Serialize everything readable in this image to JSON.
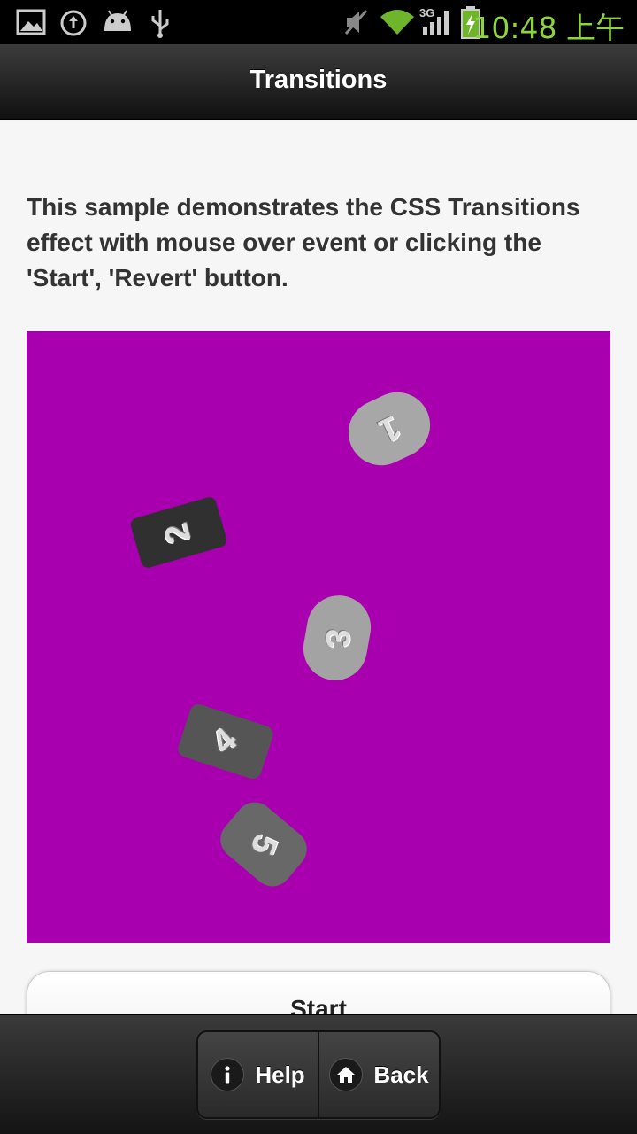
{
  "status_bar": {
    "time": "10:48 上午",
    "icons": [
      "gallery-icon",
      "sync-icon",
      "android-icon",
      "usb-icon",
      "mute-icon",
      "wifi-icon",
      "signal-3g-icon",
      "battery-charging-icon"
    ],
    "network_label": "3G"
  },
  "header": {
    "title": "Transitions"
  },
  "main": {
    "description": "This sample demonstrates the CSS Transitions effect with mouse over event or clicking the 'Start', 'Revert' button.",
    "stage_color": "#a800ae",
    "tiles": [
      {
        "label": "1"
      },
      {
        "label": "2"
      },
      {
        "label": "3"
      },
      {
        "label": "4"
      },
      {
        "label": "5"
      }
    ],
    "start_label": "Start"
  },
  "footer": {
    "help_label": "Help",
    "back_label": "Back"
  }
}
